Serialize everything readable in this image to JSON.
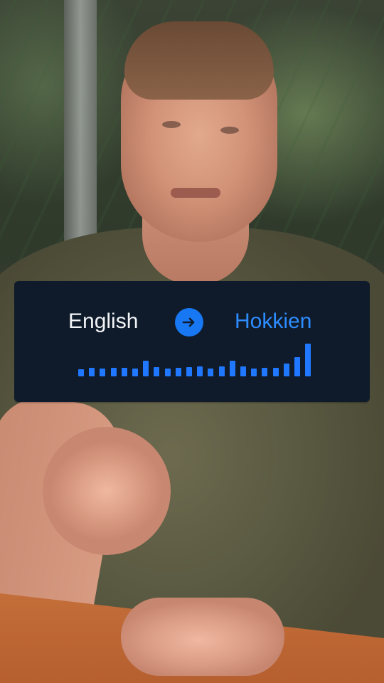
{
  "overlay": {
    "from_language": "English",
    "to_language": "Hokkien",
    "arrow_icon": "arrow-right-icon",
    "accent_color": "#1877f2",
    "text_color": "#f2f4f7",
    "to_text_color": "#2d8cff",
    "waveform_levels": [
      0.2,
      0.24,
      0.22,
      0.24,
      0.26,
      0.22,
      0.46,
      0.28,
      0.22,
      0.26,
      0.28,
      0.3,
      0.22,
      0.3,
      0.46,
      0.3,
      0.22,
      0.26,
      0.26,
      0.38,
      0.56,
      0.96
    ]
  }
}
